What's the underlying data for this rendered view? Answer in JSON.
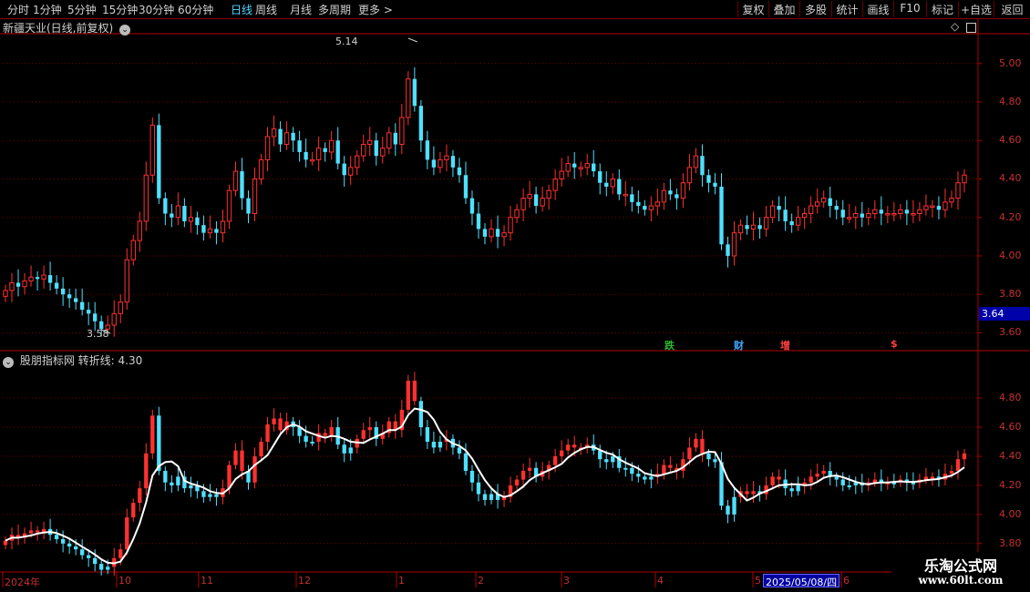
{
  "toolbar": {
    "periods": [
      "分时",
      "1分钟",
      "5分钟",
      "15分钟",
      "30分钟",
      "60分钟",
      "日线",
      "周线",
      "月线",
      "多周期",
      "更多 >"
    ],
    "active": "日线",
    "right_buttons": [
      "复权",
      "叠加",
      "多股",
      "统计",
      "画线",
      "F10",
      "标记",
      "+自选",
      "返回"
    ]
  },
  "main_chart": {
    "title": "新疆天业(日线,前复权)",
    "high_label": "5.14",
    "low_label": "3.58",
    "y_ticks": [
      "5.00",
      "4.80",
      "4.60",
      "4.40",
      "4.20",
      "4.00",
      "3.80",
      "3.60"
    ],
    "current_price": "3.64",
    "markers": [
      {
        "text": "跌",
        "color": "#2db82d"
      },
      {
        "text": "财",
        "color": "#3fa8ff"
      },
      {
        "text": "增",
        "color": "#ff4040"
      },
      {
        "text": "$",
        "color": "#ff4040"
      }
    ]
  },
  "indicator": {
    "title": "股朋指标网 转折线: 4.30",
    "y_ticks": [
      "4.80",
      "4.60",
      "4.40",
      "4.20",
      "4.00",
      "3.80"
    ]
  },
  "date_axis": {
    "labels": [
      "2024年",
      "10",
      "11",
      "12",
      "1",
      "2",
      "3",
      "4",
      "5",
      "6"
    ],
    "cursor_date": "2025/05/08/四"
  },
  "watermark": {
    "line1": "乐淘公式网",
    "line2": "www.60lt.com"
  },
  "colors": {
    "up": "#ff3030",
    "down": "#4fe0ff",
    "grid": "#7a0000",
    "axis": "#b00000",
    "line": "#ffffff"
  },
  "chart_data": {
    "type": "candlestick",
    "price_range": [
      3.55,
      5.16
    ],
    "indicator_range": [
      3.78,
      5.02
    ],
    "closes": [
      3.82,
      3.86,
      3.84,
      3.87,
      3.89,
      3.88,
      3.9,
      3.86,
      3.83,
      3.8,
      3.78,
      3.76,
      3.72,
      3.7,
      3.66,
      3.62,
      3.64,
      3.7,
      3.76,
      3.98,
      4.08,
      4.18,
      4.42,
      4.68,
      4.3,
      4.22,
      4.2,
      4.26,
      4.18,
      4.2,
      4.16,
      4.12,
      4.14,
      4.12,
      4.18,
      4.34,
      4.44,
      4.3,
      4.22,
      4.4,
      4.5,
      4.62,
      4.66,
      4.58,
      4.64,
      4.6,
      4.54,
      4.5,
      4.5,
      4.56,
      4.54,
      4.6,
      4.48,
      4.42,
      4.46,
      4.52,
      4.58,
      4.6,
      4.52,
      4.56,
      4.64,
      4.58,
      4.72,
      4.92,
      4.78,
      4.6,
      4.5,
      4.46,
      4.5,
      4.52,
      4.46,
      4.42,
      4.3,
      4.22,
      4.14,
      4.1,
      4.14,
      4.1,
      4.12,
      4.2,
      4.24,
      4.3,
      4.32,
      4.26,
      4.3,
      4.34,
      4.4,
      4.44,
      4.48,
      4.46,
      4.46,
      4.48,
      4.44,
      4.38,
      4.36,
      4.4,
      4.32,
      4.32,
      4.28,
      4.26,
      4.24,
      4.26,
      4.28,
      4.34,
      4.32,
      4.3,
      4.38,
      4.46,
      4.52,
      4.42,
      4.38,
      4.36,
      4.06,
      4.0,
      4.12,
      4.16,
      4.14,
      4.16,
      4.14,
      4.2,
      4.26,
      4.24,
      4.18,
      4.16,
      4.2,
      4.22,
      4.26,
      4.28,
      4.3,
      4.26,
      4.24,
      4.2,
      4.2,
      4.22,
      4.2,
      4.22,
      4.24,
      4.22,
      4.22,
      4.22,
      4.24,
      4.22,
      4.22,
      4.24,
      4.26,
      4.26,
      4.24,
      4.28,
      4.3,
      4.38,
      4.42
    ]
  }
}
